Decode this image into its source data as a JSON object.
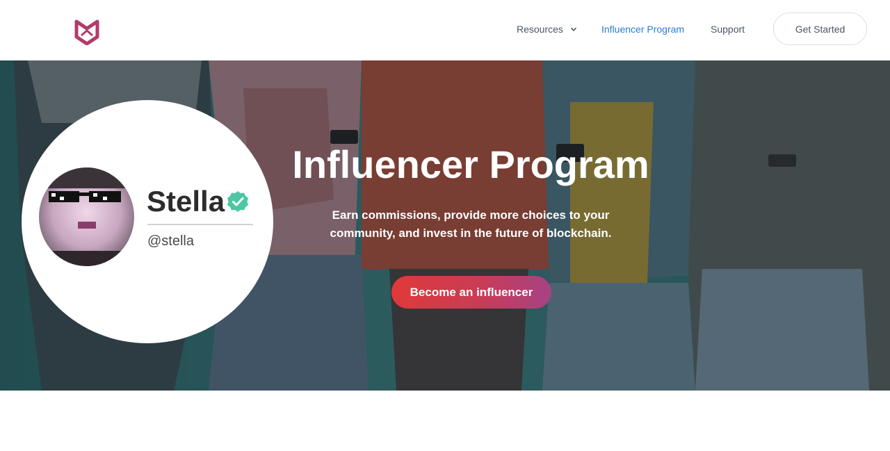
{
  "colors": {
    "brand": "#b33a6b",
    "nav_active": "#2b7bd6",
    "cta_gradient_start": "#e0393a",
    "cta_gradient_end": "#a64285",
    "verified": "#4cc7a3"
  },
  "header": {
    "logo_icon": "cat-logo-icon",
    "nav": {
      "resources": "Resources",
      "resources_icon": "chevron-down-icon",
      "influencer_program": "Influencer Program",
      "support": "Support"
    },
    "get_started": "Get Started"
  },
  "hero": {
    "title": "Influencer Program",
    "subtitle": "Earn commissions, provide more choices to your community, and invest in the future of blockchain.",
    "cta": "Become an influencer"
  },
  "profile": {
    "name": "Stella",
    "handle": "@stella",
    "verified_icon": "verified-check-icon"
  }
}
